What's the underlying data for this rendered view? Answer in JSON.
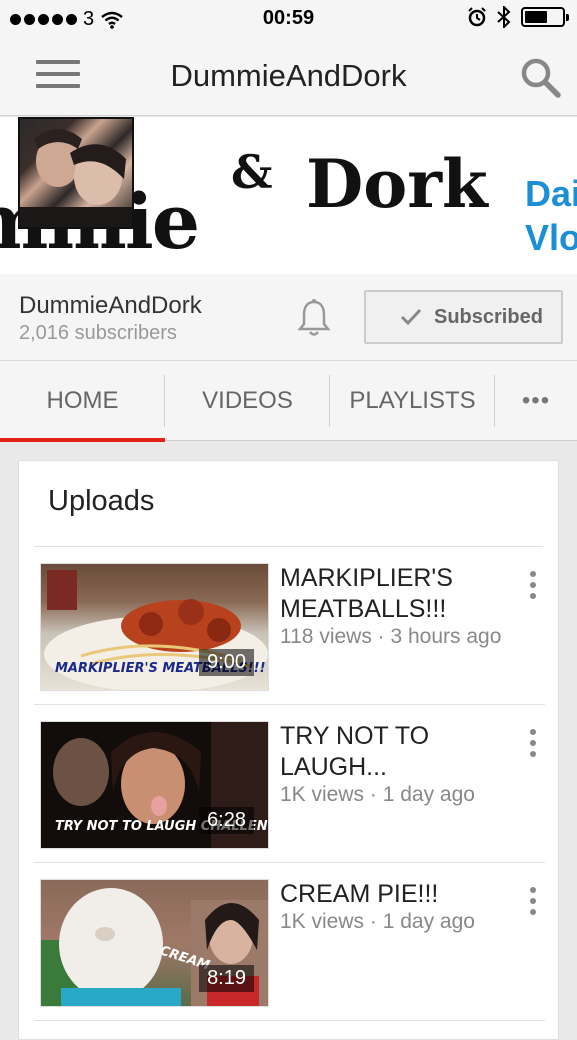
{
  "status_bar": {
    "carrier": "3",
    "time": "00:59"
  },
  "app_bar": {
    "title": "DummieAndDork"
  },
  "banner": {
    "part1": "mmie",
    "ampersand": "&",
    "part2": "Dork",
    "side_line1": "Dail",
    "side_line2": "Vlog"
  },
  "channel": {
    "name": "DummieAndDork",
    "subscribers": "2,016 subscribers",
    "subscribe_label": "Subscribed"
  },
  "tabs": [
    {
      "label": "HOME",
      "active": true
    },
    {
      "label": "VIDEOS",
      "active": false
    },
    {
      "label": "PLAYLISTS",
      "active": false
    },
    {
      "label": "•••",
      "active": false
    }
  ],
  "uploads": {
    "title": "Uploads",
    "videos": [
      {
        "title": "MARKIPLIER'S MEATBALLS!!!",
        "meta": "118 views · 3 hours ago",
        "duration": "9:00",
        "thumb_text": "MARKIPLIER'S MEATBALLS!!!"
      },
      {
        "title": "TRY NOT TO LAUGH...",
        "meta": "1K views · 1 day ago",
        "duration": "6:28",
        "thumb_text": "TRY NOT TO LAUGH CHALLENGE!!!"
      },
      {
        "title": "CREAM PIE!!!",
        "meta": "1K views · 1 day ago",
        "duration": "8:19",
        "thumb_text": "CREAM"
      }
    ]
  },
  "colors": {
    "accent": "#e62117",
    "banner_blue": "#1b8fd6"
  }
}
